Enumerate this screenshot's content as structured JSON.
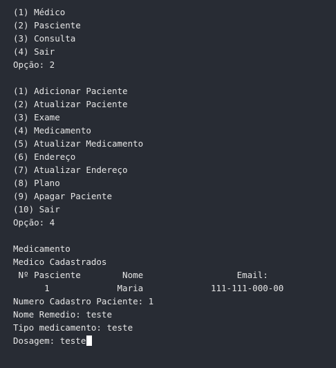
{
  "main_menu": {
    "items": [
      "(1) Médico",
      "(2) Pasciente",
      "(3) Consulta",
      "(4) Sair"
    ],
    "prompt": "Opção: 2"
  },
  "patient_menu": {
    "items": [
      "(1) Adicionar Paciente",
      "(2) Atualizar Paciente",
      "(3) Exame",
      "(4) Medicamento",
      "(5) Atualizar Medicamento",
      "(6) Endereço",
      "(7) Atualizar Endereço",
      "(8) Plano",
      "(9) Apagar Paciente",
      "(10) Sair"
    ],
    "prompt": "Opção: 4"
  },
  "medication_section": {
    "title": "Medicamento",
    "subtitle": "Medico Cadastrados",
    "table_header": " Nº Pasciente        Nome                  Email:",
    "table_row": "      1             Maria             111-111-000-00",
    "inputs": [
      "Numero Cadastro Paciente: 1",
      "Nome Remedio: teste",
      "Tipo medicamento: teste"
    ],
    "current_input_label": "Dosagem: ",
    "current_input_value": "teste"
  }
}
